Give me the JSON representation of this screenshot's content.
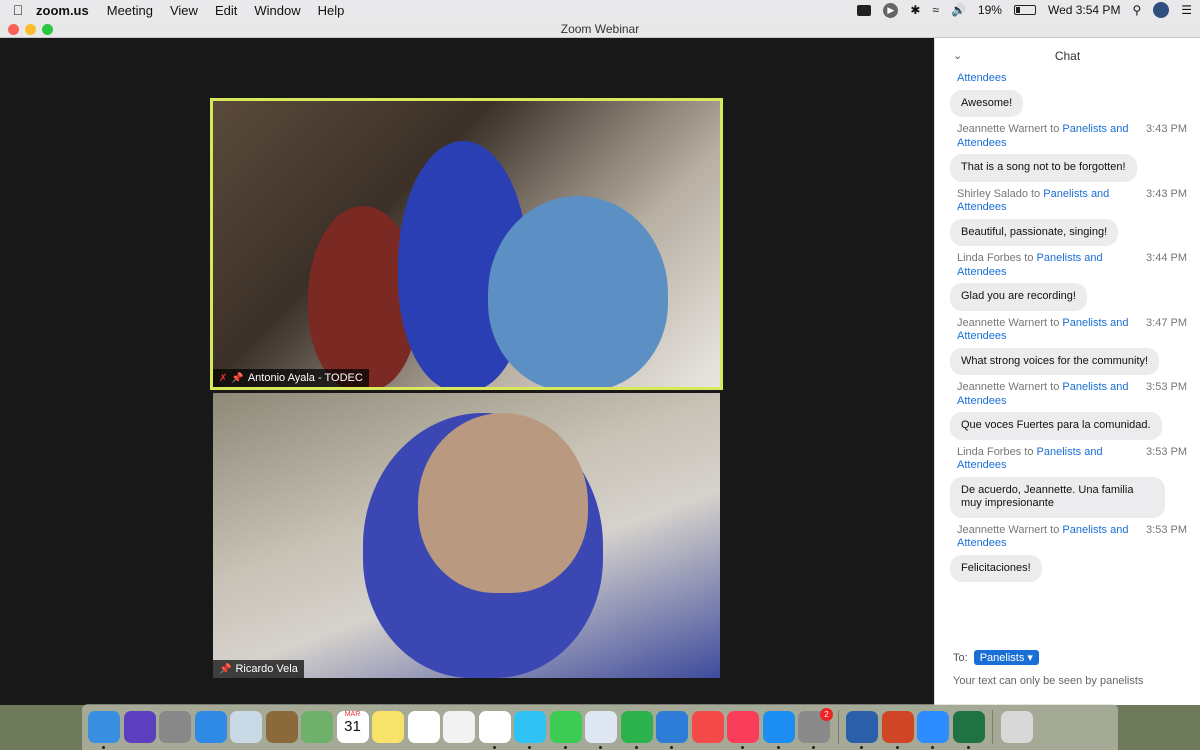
{
  "menubar": {
    "app_name": "zoom.us",
    "menus": [
      "Meeting",
      "View",
      "Edit",
      "Window",
      "Help"
    ],
    "battery": "19%",
    "clock": "Wed 3:54 PM"
  },
  "window": {
    "title": "Zoom Webinar"
  },
  "videos": [
    {
      "name": "Antonio Ayala - TODEC"
    },
    {
      "name": "Ricardo Vela"
    }
  ],
  "chat": {
    "title": "Chat",
    "top_fragment": "Attendees",
    "messages": [
      {
        "bubble": "Awesome!"
      },
      {
        "sender": "Jeannette Warnert",
        "to": "to",
        "target": "Panelists and Attendees",
        "time": "3:43 PM",
        "bubble": "That is a song not to be forgotten!"
      },
      {
        "sender": "Shirley Salado",
        "to": "to",
        "target": "Panelists and Attendees",
        "time": "3:43 PM",
        "bubble": "Beautiful, passionate, singing!"
      },
      {
        "sender": "Linda Forbes",
        "to": "to",
        "target": "Panelists and Attendees",
        "time": "3:44 PM",
        "bubble": "Glad you are recording!"
      },
      {
        "sender": "Jeannette Warnert",
        "to": "to",
        "target": "Panelists and Attendees",
        "time": "3:47 PM",
        "bubble": "What strong voices for the community!"
      },
      {
        "sender": "Jeannette Warnert",
        "to": "to",
        "target": "Panelists and Attendees",
        "time": "3:53 PM",
        "bubble": "Que voces Fuertes para la comunidad."
      },
      {
        "sender": "Linda Forbes",
        "to": "to",
        "target": "Panelists and Attendees",
        "time": "3:53 PM",
        "bubble": "De acuerdo, Jeannette. Una familia muy impresionante"
      },
      {
        "sender": "Jeannette Warnert",
        "to": "to",
        "target": "Panelists and Attendees",
        "time": "3:53 PM",
        "bubble": "Felicitaciones!"
      }
    ],
    "to_label": "To:",
    "recipient": "Panelists ▾",
    "hint": "Your text can only be seen by panelists"
  },
  "dock": {
    "calendar_month": "MAR",
    "calendar_day": "31",
    "settings_badge": "2",
    "icons": [
      "finder-icon",
      "siri-icon",
      "launchpad-icon",
      "safari-icon",
      "mail-stamp-icon",
      "contacts-icon",
      "maps-icon",
      "calendar-icon",
      "notes-icon",
      "reminders-icon",
      "photos-icon",
      "chrome-icon",
      "messages-icon",
      "facetime-icon",
      "preview-icon",
      "numbers-icon",
      "keynote-icon",
      "news-icon",
      "music-icon",
      "appstore-icon",
      "system-preferences-icon",
      "word-icon",
      "powerpoint-icon",
      "zoom-icon",
      "excel-icon",
      "trash-icon"
    ],
    "colors": [
      "#3a8fe0",
      "#5b3fbf",
      "#888",
      "#2f8ae6",
      "#c9d9e6",
      "#8a6a3a",
      "#6fb06a",
      "#fff",
      "#f7e36a",
      "#fff",
      "#f2f2f2",
      "#fff",
      "#2fc2f5",
      "#3ccb53",
      "#dfe8f2",
      "#2bb24c",
      "#2d7dd8",
      "#f54a4a",
      "#fa3d5b",
      "#1c8ef2",
      "#8a8a8a",
      "#2b5faa",
      "#d04525",
      "#2d8cff",
      "#1f7244",
      "#d8d8d8"
    ]
  }
}
